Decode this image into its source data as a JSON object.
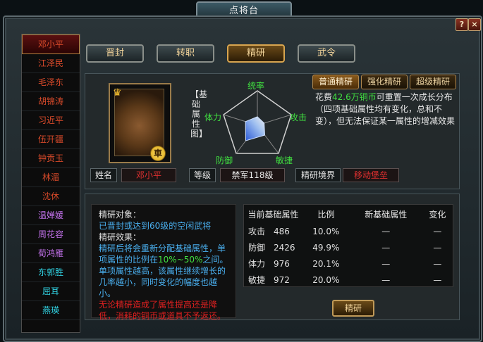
{
  "window": {
    "title": "点将台"
  },
  "controls": {
    "help": "?",
    "close": "×"
  },
  "generals": [
    {
      "name": "邓小平",
      "color": "red",
      "selected": true
    },
    {
      "name": "江泽民",
      "color": "red"
    },
    {
      "name": "毛泽东",
      "color": "red"
    },
    {
      "name": "胡锦涛",
      "color": "red"
    },
    {
      "name": "习近平",
      "color": "red"
    },
    {
      "name": "伍开疆",
      "color": "red"
    },
    {
      "name": "钟贡玉",
      "color": "red"
    },
    {
      "name": "林湄",
      "color": "red"
    },
    {
      "name": "沈休",
      "color": "red"
    },
    {
      "name": "温婵媛",
      "color": "purple"
    },
    {
      "name": "周花容",
      "color": "purple"
    },
    {
      "name": "荀鸿雁",
      "color": "purple"
    },
    {
      "name": "东郭胜",
      "color": "cyan"
    },
    {
      "name": "屈耳",
      "color": "cyan"
    },
    {
      "name": "燕瑛",
      "color": "cyan"
    }
  ],
  "top_buttons": [
    "晋封",
    "转职",
    "精研",
    "武令"
  ],
  "active_button": 2,
  "portrait": {
    "badge": "車"
  },
  "radar": {
    "title": "【基础属性图】",
    "labels": {
      "top": "统率",
      "left": "体力",
      "right": "攻击",
      "bottom_left": "防御",
      "bottom_right": "敏捷"
    },
    "values": {
      "统率": 0.25,
      "攻击": 0.2,
      "敏捷": 0.35,
      "防御": 0.55,
      "体力": 0.35
    }
  },
  "tabs": [
    "普通精研",
    "强化精研",
    "超级精研"
  ],
  "active_tab": 0,
  "description": {
    "pre": "花费",
    "cost": "42.6万铜币",
    "post": "可重置一次成长分布（四项基础属性均有变化，总和不变），但无法保证某一属性的增减效果"
  },
  "info": {
    "name_label": "姓名",
    "name_value": "邓小平",
    "level_label": "等级",
    "level_value": "禁军118级",
    "realm_label": "精研境界",
    "realm_value": "移动堡垒"
  },
  "effect": {
    "target_title": "精研对象：",
    "target_text": "已晋封或达到60级的空闲武将",
    "effect_title": "精研效果：",
    "effect_text_pre": "精研后将会重新分配基础属性，单项属性的比例在",
    "effect_range": "10%~50%",
    "effect_text_post": "之间。单项属性越高，该属性继续增长的几率越小，同时变化的幅度也越小。",
    "warning": "无论精研造成了属性提高还是降低，消耗的铜币或道具不予返还。"
  },
  "attr_table": {
    "headers": [
      "当前基础属性",
      "比例",
      "新基础属性",
      "变化"
    ],
    "rows": [
      {
        "name": "攻击",
        "value": "486",
        "ratio": "10.0%",
        "new": "—",
        "change": "—"
      },
      {
        "name": "防御",
        "value": "2426",
        "ratio": "49.9%",
        "new": "—",
        "change": "—"
      },
      {
        "name": "体力",
        "value": "976",
        "ratio": "20.1%",
        "new": "—",
        "change": "—"
      },
      {
        "name": "敏捷",
        "value": "972",
        "ratio": "20.0%",
        "new": "—",
        "change": "—"
      }
    ]
  },
  "refine_button": "精研",
  "colors": {
    "red": "#d84a2a",
    "purple": "#c070e8",
    "cyan": "#30d0e0",
    "accent": "#40e040"
  }
}
